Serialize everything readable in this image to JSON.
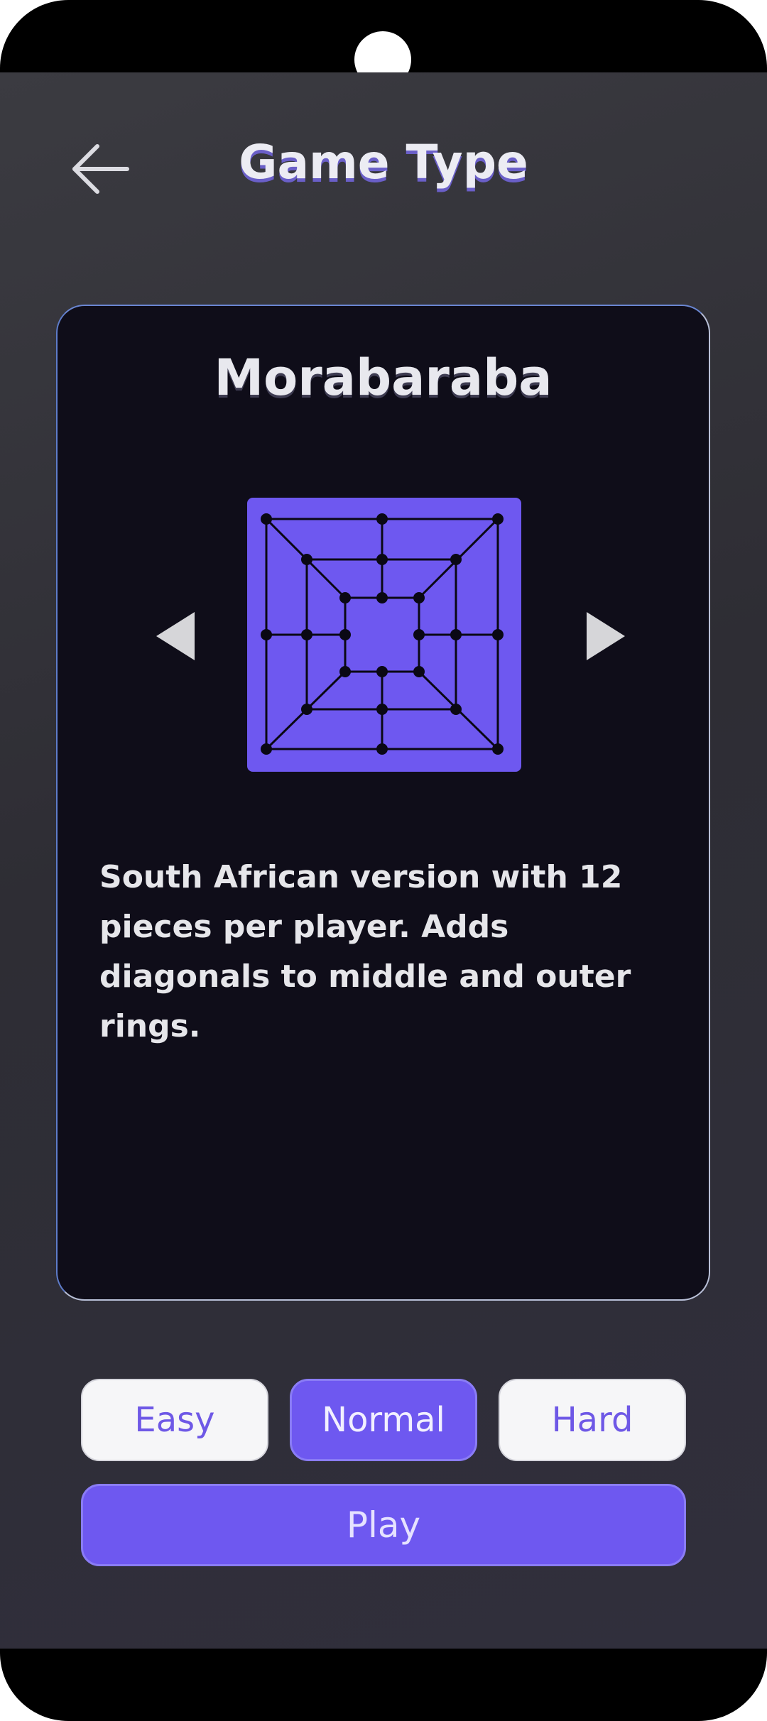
{
  "header": {
    "title": "Game Type",
    "back_icon": "arrow-left-icon"
  },
  "game": {
    "name": "Morabaraba",
    "description": "South African version with 12 pieces per player. Adds diagonals to middle and outer rings.",
    "board_color": "#6e58f0",
    "prev_icon": "triangle-left-icon",
    "next_icon": "triangle-right-icon"
  },
  "difficulty": {
    "options": [
      "Easy",
      "Normal",
      "Hard"
    ],
    "selected": "Normal"
  },
  "play_label": "Play",
  "colors": {
    "accent": "#6e58f0",
    "card_background": "#0f0d19"
  }
}
